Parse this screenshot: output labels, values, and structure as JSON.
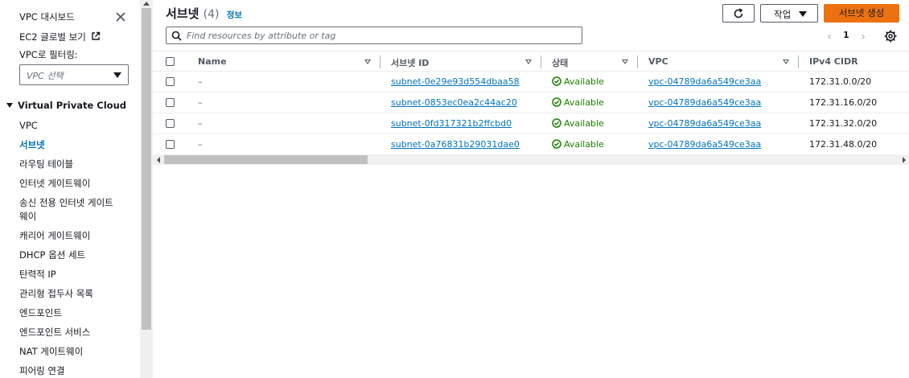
{
  "sidebar": {
    "dashboard_link": "VPC 대시보드",
    "ec2_global_view": "EC2 글로벌 보기",
    "filter_label": "VPC로 필터링:",
    "vpc_select_placeholder": "VPC 선택",
    "section_title": "Virtual Private Cloud",
    "items": [
      {
        "label": "VPC",
        "active": false
      },
      {
        "label": "서브넷",
        "active": true
      },
      {
        "label": "라우팅 테이블",
        "active": false
      },
      {
        "label": "인터넷 게이트웨이",
        "active": false
      },
      {
        "label": "송신 전용 인터넷 게이트",
        "active": false
      },
      {
        "label": "웨이",
        "active": false
      },
      {
        "label": "캐리어 게이트웨이",
        "active": false
      },
      {
        "label": "DHCP 옵션 세트",
        "active": false
      },
      {
        "label": "탄력적 IP",
        "active": false
      },
      {
        "label": "관리형 접두사 목록",
        "active": false
      },
      {
        "label": "엔드포인트",
        "active": false
      },
      {
        "label": "엔드포인트 서비스",
        "active": false
      },
      {
        "label": "NAT 게이트웨이",
        "active": false
      },
      {
        "label": "피어링 연결",
        "active": false
      }
    ]
  },
  "header": {
    "title": "서브넷",
    "count": "(4)",
    "info_link": "정보",
    "actions_label": "작업",
    "create_label": "서브넷 생성"
  },
  "search": {
    "placeholder": "Find resources by attribute or tag"
  },
  "pagination": {
    "current_page": "1"
  },
  "table": {
    "columns": [
      "Name",
      "서브넷 ID",
      "상태",
      "VPC",
      "IPv4 CIDR"
    ],
    "rows": [
      {
        "name": "–",
        "subnet_id": "subnet-0e29e93d554dbaa58",
        "state": "Available",
        "vpc": "vpc-04789da6a549ce3aa",
        "cidr": "172.31.0.0/20"
      },
      {
        "name": "–",
        "subnet_id": "subnet-0853ec0ea2c44ac20",
        "state": "Available",
        "vpc": "vpc-04789da6a549ce3aa",
        "cidr": "172.31.16.0/20"
      },
      {
        "name": "–",
        "subnet_id": "subnet-0fd317321b2ffcbd0",
        "state": "Available",
        "vpc": "vpc-04789da6a549ce3aa",
        "cidr": "172.31.32.0/20"
      },
      {
        "name": "–",
        "subnet_id": "subnet-0a76831b29031dae0",
        "state": "Available",
        "vpc": "vpc-04789da6a549ce3aa",
        "cidr": "172.31.48.0/20"
      }
    ]
  },
  "colors": {
    "accent_orange": "#ec7211",
    "link_blue": "#0073bb",
    "status_green": "#1d8102"
  }
}
